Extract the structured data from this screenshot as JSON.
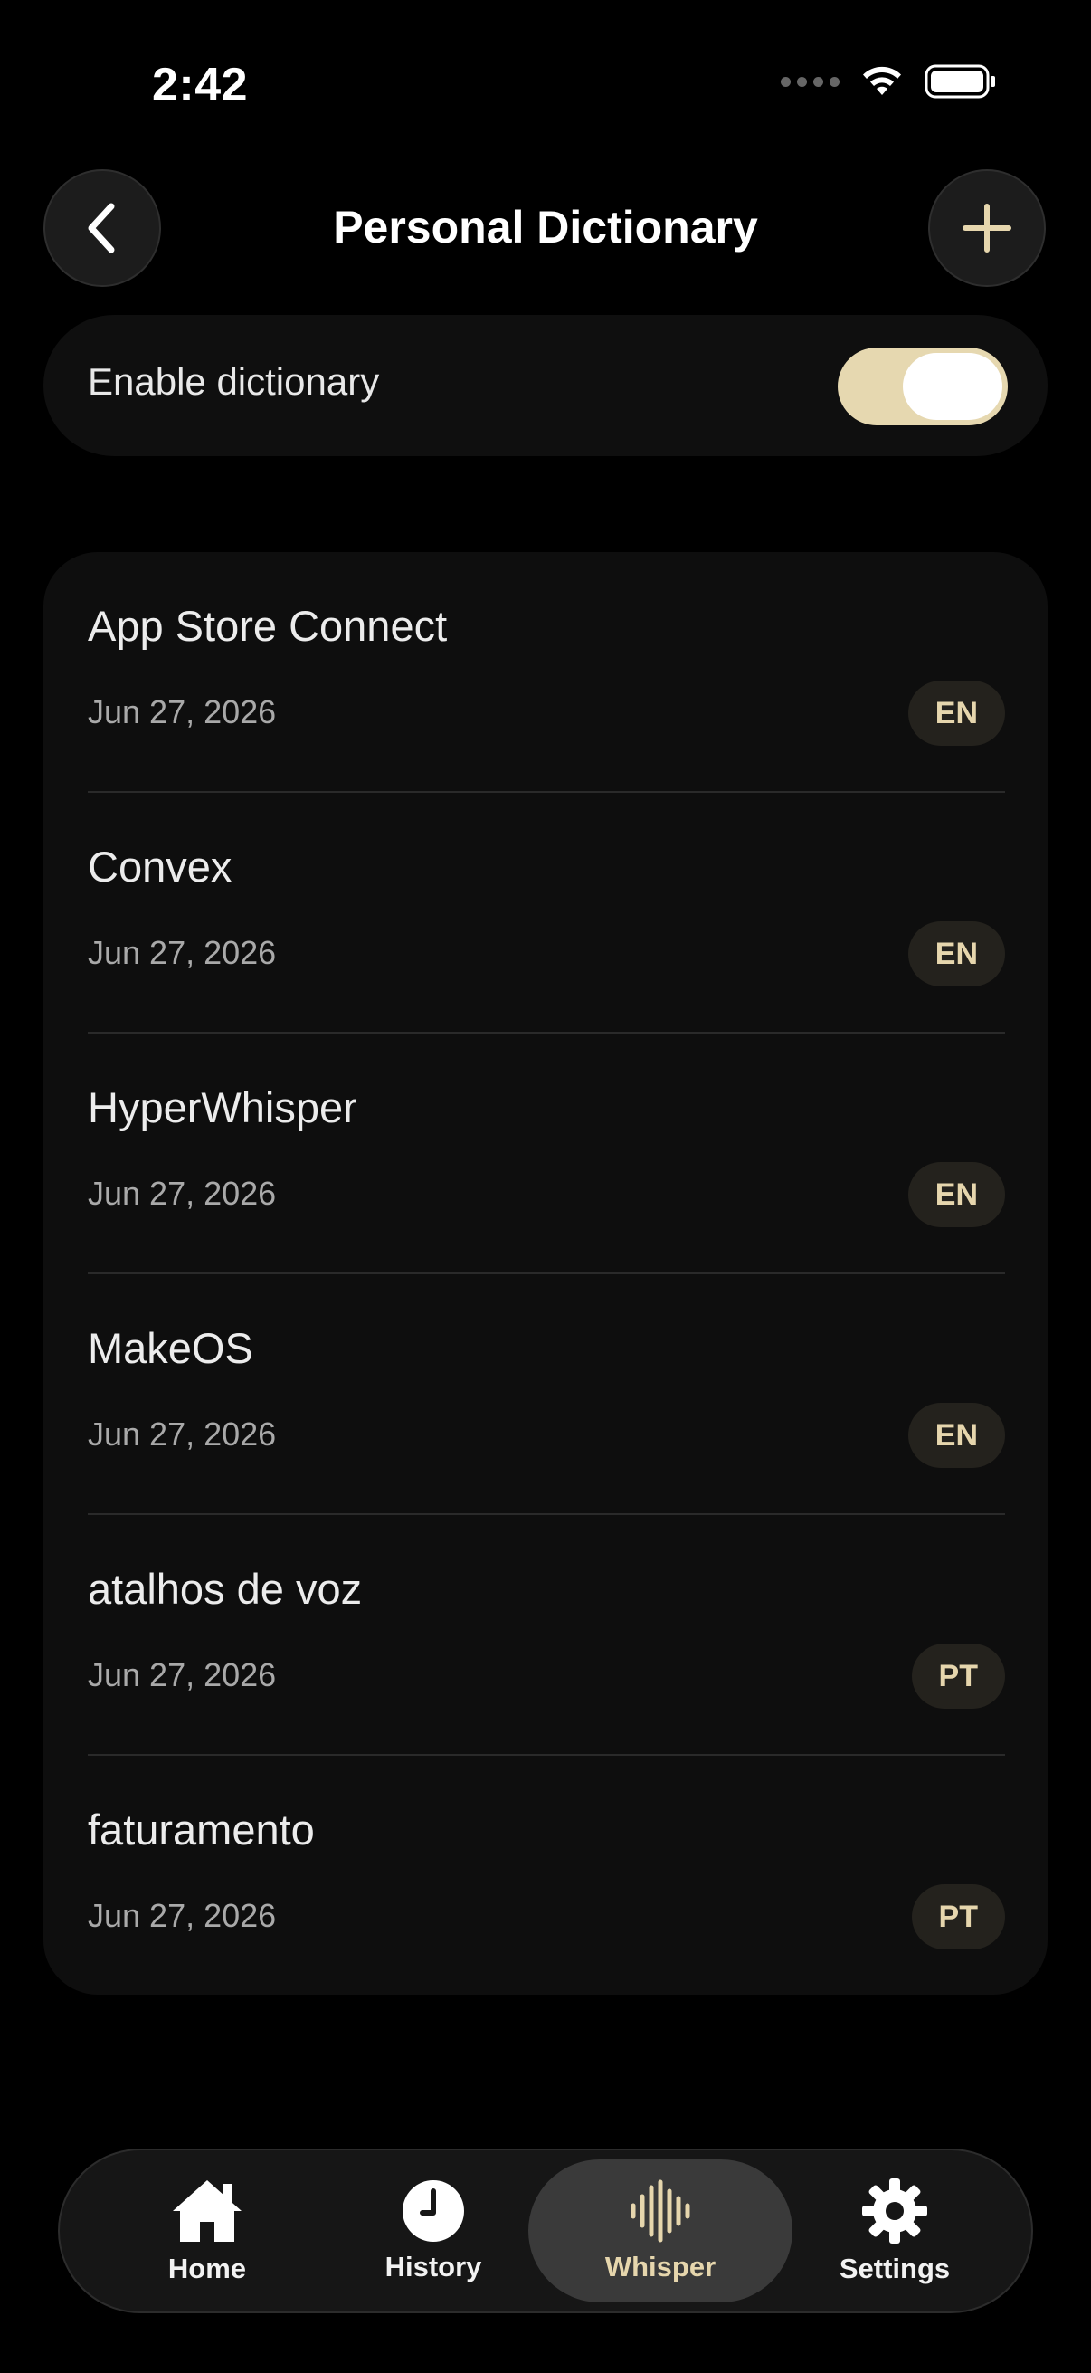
{
  "status_bar": {
    "time": "2:42"
  },
  "header": {
    "title": "Personal Dictionary",
    "back_icon": "chevron-left-icon",
    "add_icon": "plus-icon"
  },
  "toggle": {
    "label": "Enable dictionary",
    "enabled": true
  },
  "entries": [
    {
      "term": "App Store Connect",
      "date": "Jun 27, 2026",
      "lang": "EN"
    },
    {
      "term": "Convex",
      "date": "Jun 27, 2026",
      "lang": "EN"
    },
    {
      "term": "HyperWhisper",
      "date": "Jun 27, 2026",
      "lang": "EN"
    },
    {
      "term": "MakeOS",
      "date": "Jun 27, 2026",
      "lang": "EN"
    },
    {
      "term": "atalhos de voz",
      "date": "Jun 27, 2026",
      "lang": "PT"
    },
    {
      "term": "faturamento",
      "date": "Jun 27, 2026",
      "lang": "PT"
    }
  ],
  "tabs": [
    {
      "label": "Home",
      "icon": "house-icon"
    },
    {
      "label": "History",
      "icon": "clock-icon"
    },
    {
      "label": "Whisper",
      "icon": "waveform-icon",
      "active": true
    },
    {
      "label": "Settings",
      "icon": "gear-icon"
    }
  ],
  "colors": {
    "background": "#000000",
    "accent": "#e6d6ad",
    "card": "#0e0e0e"
  }
}
